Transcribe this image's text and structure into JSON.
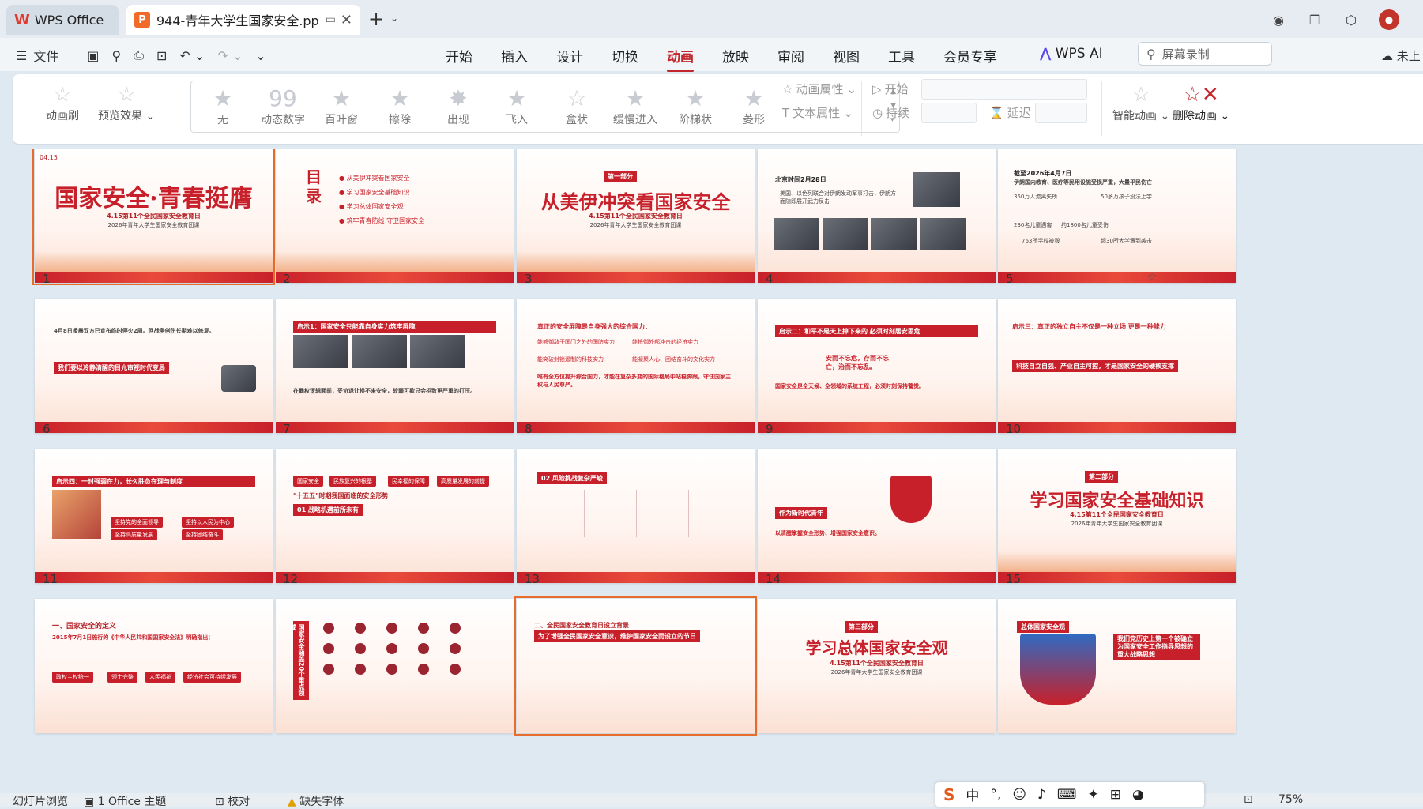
{
  "titlebar": {
    "home_tab": "WPS Office",
    "doc_tab": "944-青年大学生国家安全.pp",
    "doc_icon": "P",
    "new_tab": "+"
  },
  "menubar": {
    "file": "文件",
    "tabs": [
      "开始",
      "插入",
      "设计",
      "切换",
      "动画",
      "放映",
      "审阅",
      "视图",
      "工具",
      "会员专享"
    ],
    "active_tab": "动画",
    "wps_ai": "WPS AI",
    "search_placeholder": "屏幕录制",
    "cloud": "未上"
  },
  "ribbon": {
    "anim_brush": "动画刷",
    "preview": "预览效果",
    "effects": [
      "无",
      "动态数字",
      "百叶窗",
      "擦除",
      "出现",
      "飞入",
      "盒状",
      "缓慢进入",
      "阶梯状",
      "菱形"
    ],
    "anim_props": "动画属性",
    "text_props": "文本属性",
    "start": "开始",
    "duration": "持续",
    "delay": "延迟",
    "smart_anim": "智能动画",
    "delete_anim": "删除动画"
  },
  "slides": [
    {
      "n": "1",
      "title": "国家安全·青春挺膺",
      "sub": "4.15第11个全民国家安全教育日",
      "line": "2026年青年大学生国家安全教育团课",
      "date": "04.15"
    },
    {
      "n": "2",
      "heading": "目录",
      "items": [
        "从美伊冲突看国家安全",
        "学习国家安全基础知识",
        "学习总体国家安全观",
        "筑牢青春防线 守卫国家安全"
      ]
    },
    {
      "n": "3",
      "part": "第一部分",
      "title": "从美伊冲突看国家安全",
      "sub": "4.15第11个全民国家安全教育日",
      "line": "2026年青年大学生国家安全教育团课"
    },
    {
      "n": "4",
      "head": "北京时间2月28日",
      "text": "美国、以色列联合对伊朗发动军事打击，伊朗方面随即展开武力反击"
    },
    {
      "n": "5",
      "head": "截至2026年4月7日",
      "text": "伊朗国内教育、医疗等民用设施受损严重，大量平民伤亡",
      "facts": [
        "350万人流离失所",
        "50多万孩子没法上学",
        "230名儿童遇害",
        "约1800名儿童受伤",
        "763所学校被毁",
        "超30所大学遭到袭击"
      ]
    },
    {
      "n": "6",
      "text": "4月8日凌晨双方已宣布临时停火2周。但战争创伤长期难以修复。",
      "banner": "我们要以冷静清醒的目光审视时代变局"
    },
    {
      "n": "7",
      "banner": "启示1：国家安全只能靠自身实力筑牢屏障",
      "text": "在霸权逻辑面前，妥协退让换不来安全，软弱可欺只会招致更严重的打压。"
    },
    {
      "n": "8",
      "head": "真正的安全屏障是自身强大的综合国力：",
      "items": [
        "能够御敌于国门之外的国防实力",
        "能抵御外部冲击的经济实力",
        "能突破封锁遏制的科技实力",
        "能凝聚人心、团结奋斗的文化实力"
      ],
      "foot": "唯有全方位提升综合国力，才能在复杂多变的国际格局中站稳脚跟，守住国家主权与人民尊严。"
    },
    {
      "n": "9",
      "banner": "启示二：和平不是天上掉下来的 必须时刻居安思危",
      "quote": "安而不忘危，存而不忘亡，治而不忘乱。",
      "foot": "国家安全是全天候、全领域的系统工程，必须时刻保持警觉。"
    },
    {
      "n": "10",
      "banner": "启示三：真正的独立自主不仅是一种立场 更是一种能力",
      "tag": "科技自立自强、产业自主可控，才是国家安全的硬核支撑"
    },
    {
      "n": "11",
      "banner": "启示四：一时强弱在力，长久胜负在理与制度",
      "pills": [
        "坚持党的全面领导",
        "坚持以人民为中心",
        "坚持高质量发展",
        "坚持团结奋斗"
      ]
    },
    {
      "n": "12",
      "tags": [
        "国家安全",
        "民族复兴的根基",
        "民幸福的保障",
        "高质量发展的前提"
      ],
      "head": "\"十五五\"时期我国面临的安全形势",
      "sub": "01 战略机遇前所未有"
    },
    {
      "n": "13",
      "head": "02 风险挑战复杂严峻"
    },
    {
      "n": "14",
      "banner": "作为新时代青年",
      "foot": "以清醒掌握安全形势、增强国家安全意识。"
    },
    {
      "n": "15",
      "part": "第二部分",
      "title": "学习国家安全基础知识",
      "sub": "4.15第11个全民国家安全教育日",
      "line": "2026年青年大学生国家安全教育团课"
    },
    {
      "n": "16",
      "head": "一、国家安全的定义",
      "sub": "2015年7月1日施行的《中华人民共和国国家安全法》明确指出：",
      "pills": [
        "政权主权统一",
        "领土完整",
        "人民福祉",
        "经济社会可持续发展"
      ]
    },
    {
      "n": "17",
      "side": "国家安全涵盖20个重点领域"
    },
    {
      "n": "18",
      "head": "二、全民国家安全教育日设立背景",
      "sub": "为了增强全民国家安全意识，维护国家安全而设立的节日"
    },
    {
      "n": "19",
      "part": "第三部分",
      "title": "学习总体国家安全观",
      "sub": "4.15第11个全民国家安全教育日",
      "line": "2026年青年大学生国家安全教育团课"
    },
    {
      "n": "20",
      "badge": "总体国家安全观",
      "text": "我们党历史上第一个被确立为国家安全工作指导思想的重大战略思想"
    }
  ],
  "statusbar": {
    "slide_browse": "幻灯片浏览",
    "theme": "1 Office 主题",
    "proof": "校对",
    "missing_font": "缺失字体",
    "zoom": "75%"
  },
  "ime": {
    "mode": "中"
  },
  "colors": {
    "accent": "#c1272d",
    "slide_red": "#c8202a",
    "selection": "#e86c2c"
  }
}
